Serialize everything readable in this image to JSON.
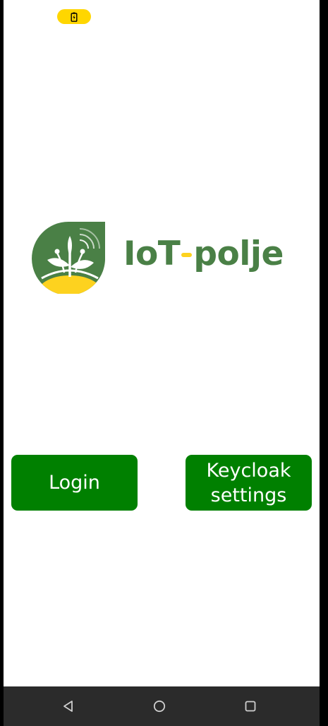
{
  "status_bar": {
    "battery_icon": "battery-charging-icon",
    "pill_color": "#ffd600"
  },
  "logo": {
    "text_before": "IoT",
    "text_after": "polje",
    "text_color": "#4a8046",
    "dash_color": "#fdd21f",
    "mark_color": "#4a8046",
    "ground_color": "#fdd21f"
  },
  "buttons": {
    "login_label": "Login",
    "settings_label": "Keycloak settings",
    "color": "#008000"
  },
  "navbar": {
    "color": "#2b2b2b",
    "icon_color": "#cfcfcf",
    "back_icon": "back-triangle-icon",
    "home_icon": "home-circle-icon",
    "recents_icon": "recents-square-icon"
  }
}
